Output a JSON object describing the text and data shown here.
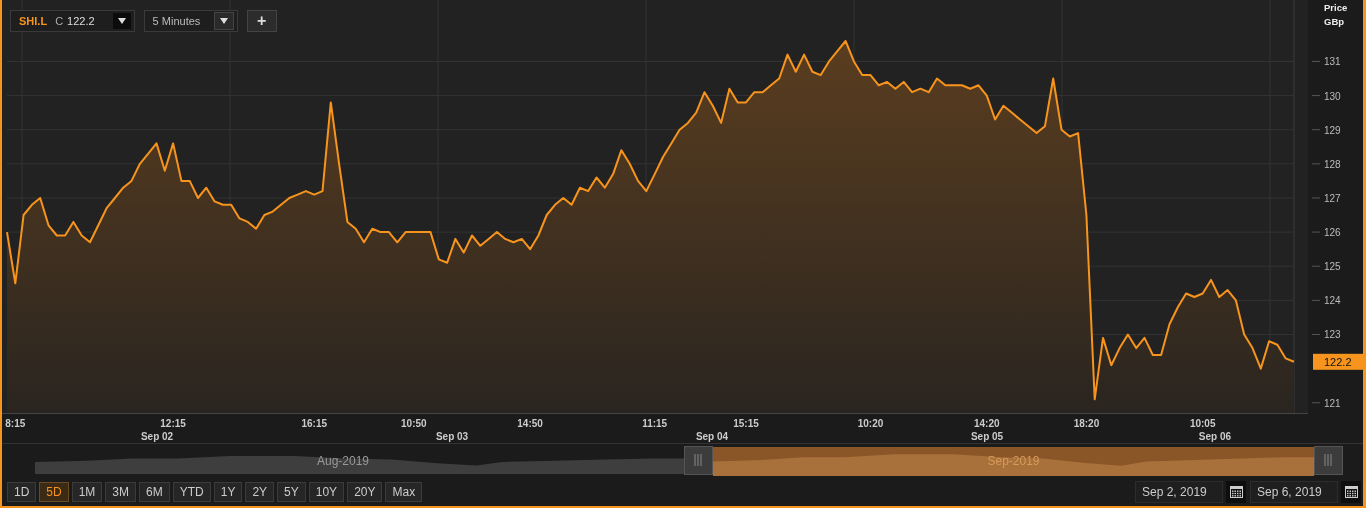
{
  "toolbar": {
    "price_type": "C",
    "price": "122.2",
    "interval": "5 Minutes",
    "add_button": "+"
  },
  "price_axis": {
    "title": "Price",
    "unit": "GBp"
  },
  "last_price": "122.2",
  "chart_data": {
    "type": "area",
    "grid": true,
    "ylim": [
      120.7,
      132.8
    ],
    "yticks": [
      121,
      123,
      124,
      125,
      126,
      127,
      128,
      129,
      130,
      131
    ],
    "categories": [
      null,
      "8:15",
      null,
      null,
      null,
      null,
      null,
      null,
      null,
      null,
      null,
      null,
      null,
      null,
      null,
      null,
      null,
      null,
      null,
      null,
      "12:15",
      null,
      null,
      null,
      null,
      null,
      null,
      null,
      null,
      null,
      null,
      null,
      null,
      null,
      null,
      null,
      null,
      "16:15",
      null,
      null,
      null,
      null,
      null,
      null,
      null,
      null,
      null,
      null,
      null,
      "10:50",
      null,
      null,
      null,
      null,
      null,
      null,
      null,
      null,
      null,
      null,
      null,
      null,
      null,
      "14:50",
      null,
      null,
      null,
      null,
      null,
      null,
      null,
      null,
      null,
      null,
      null,
      null,
      null,
      null,
      "11:15",
      null,
      null,
      null,
      null,
      null,
      null,
      null,
      null,
      null,
      null,
      "15:15",
      null,
      null,
      null,
      null,
      null,
      null,
      null,
      null,
      null,
      null,
      null,
      null,
      null,
      null,
      "10:20",
      null,
      null,
      null,
      null,
      null,
      null,
      null,
      null,
      null,
      null,
      null,
      null,
      null,
      "14:20",
      null,
      null,
      null,
      null,
      null,
      null,
      null,
      null,
      null,
      null,
      null,
      "18:20",
      null,
      null,
      null,
      null,
      null,
      null,
      null,
      null,
      null,
      null,
      null,
      null,
      null,
      "10:05",
      null,
      null,
      null,
      null,
      null,
      null,
      null,
      null,
      null,
      null,
      null
    ],
    "annotations": [
      "Sep 02",
      "Sep 03",
      "Sep 04",
      "Sep 05",
      "Sep 06"
    ],
    "series": [
      {
        "name": "SHI.L",
        "color": "#f7941d",
        "values": [
          126,
          124.5,
          126.5,
          126.8,
          127,
          126.2,
          125.9,
          125.9,
          126.3,
          125.9,
          125.7,
          126.2,
          126.7,
          127,
          127.3,
          127.5,
          128,
          128.3,
          128.6,
          127.8,
          128.6,
          127.5,
          127.5,
          127,
          127.3,
          126.9,
          126.8,
          126.8,
          126.4,
          126.3,
          126.1,
          126.5,
          126.6,
          126.8,
          127,
          127.1,
          127.2,
          127.1,
          127.2,
          129.8,
          128,
          126.3,
          126.1,
          125.7,
          126.1,
          126,
          126,
          125.7,
          126,
          126,
          126,
          126,
          125.2,
          125.1,
          125.8,
          125.4,
          125.9,
          125.6,
          125.8,
          126,
          125.8,
          125.7,
          125.8,
          125.5,
          125.9,
          126.5,
          126.8,
          127,
          126.8,
          127.3,
          127.2,
          127.6,
          127.3,
          127.7,
          128.4,
          128,
          127.5,
          127.2,
          127.7,
          128.2,
          128.6,
          129,
          129.2,
          129.5,
          130.1,
          129.7,
          129.2,
          130.2,
          129.8,
          129.8,
          130.1,
          130.1,
          130.3,
          130.5,
          131.2,
          130.7,
          131.2,
          130.7,
          130.6,
          131,
          131.3,
          131.6,
          131,
          130.6,
          130.6,
          130.3,
          130.4,
          130.2,
          130.4,
          130.1,
          130.2,
          130.1,
          130.5,
          130.3,
          130.3,
          130.3,
          130.2,
          130.3,
          130,
          129.3,
          129.7,
          129.5,
          129.3,
          129.1,
          128.9,
          129.1,
          130.5,
          129,
          128.8,
          128.9,
          126.5,
          121.1,
          122.9,
          122.1,
          122.6,
          123,
          122.6,
          122.9,
          122.4,
          122.4,
          123.3,
          123.8,
          124.2,
          124.1,
          124.2,
          124.6,
          124.1,
          124.3,
          124,
          123,
          122.6,
          122,
          122.8,
          122.7,
          122.3,
          122.2
        ]
      }
    ]
  },
  "navigator": {
    "periods": [
      {
        "label": "Aug-2019",
        "selected": false
      },
      {
        "label": "Sep-2019",
        "selected": true
      }
    ]
  },
  "range_buttons": [
    {
      "label": "1D",
      "selected": false
    },
    {
      "label": "5D",
      "selected": true
    },
    {
      "label": "1M",
      "selected": false
    },
    {
      "label": "3M",
      "selected": false
    },
    {
      "label": "6M",
      "selected": false
    },
    {
      "label": "YTD",
      "selected": false
    },
    {
      "label": "1Y",
      "selected": false
    },
    {
      "label": "2Y",
      "selected": false
    },
    {
      "label": "5Y",
      "selected": false
    },
    {
      "label": "10Y",
      "selected": false
    },
    {
      "label": "20Y",
      "selected": false
    },
    {
      "label": "Max",
      "selected": false
    }
  ],
  "date_range": {
    "from": "Sep 2, 2019",
    "to": "Sep 6, 2019"
  }
}
